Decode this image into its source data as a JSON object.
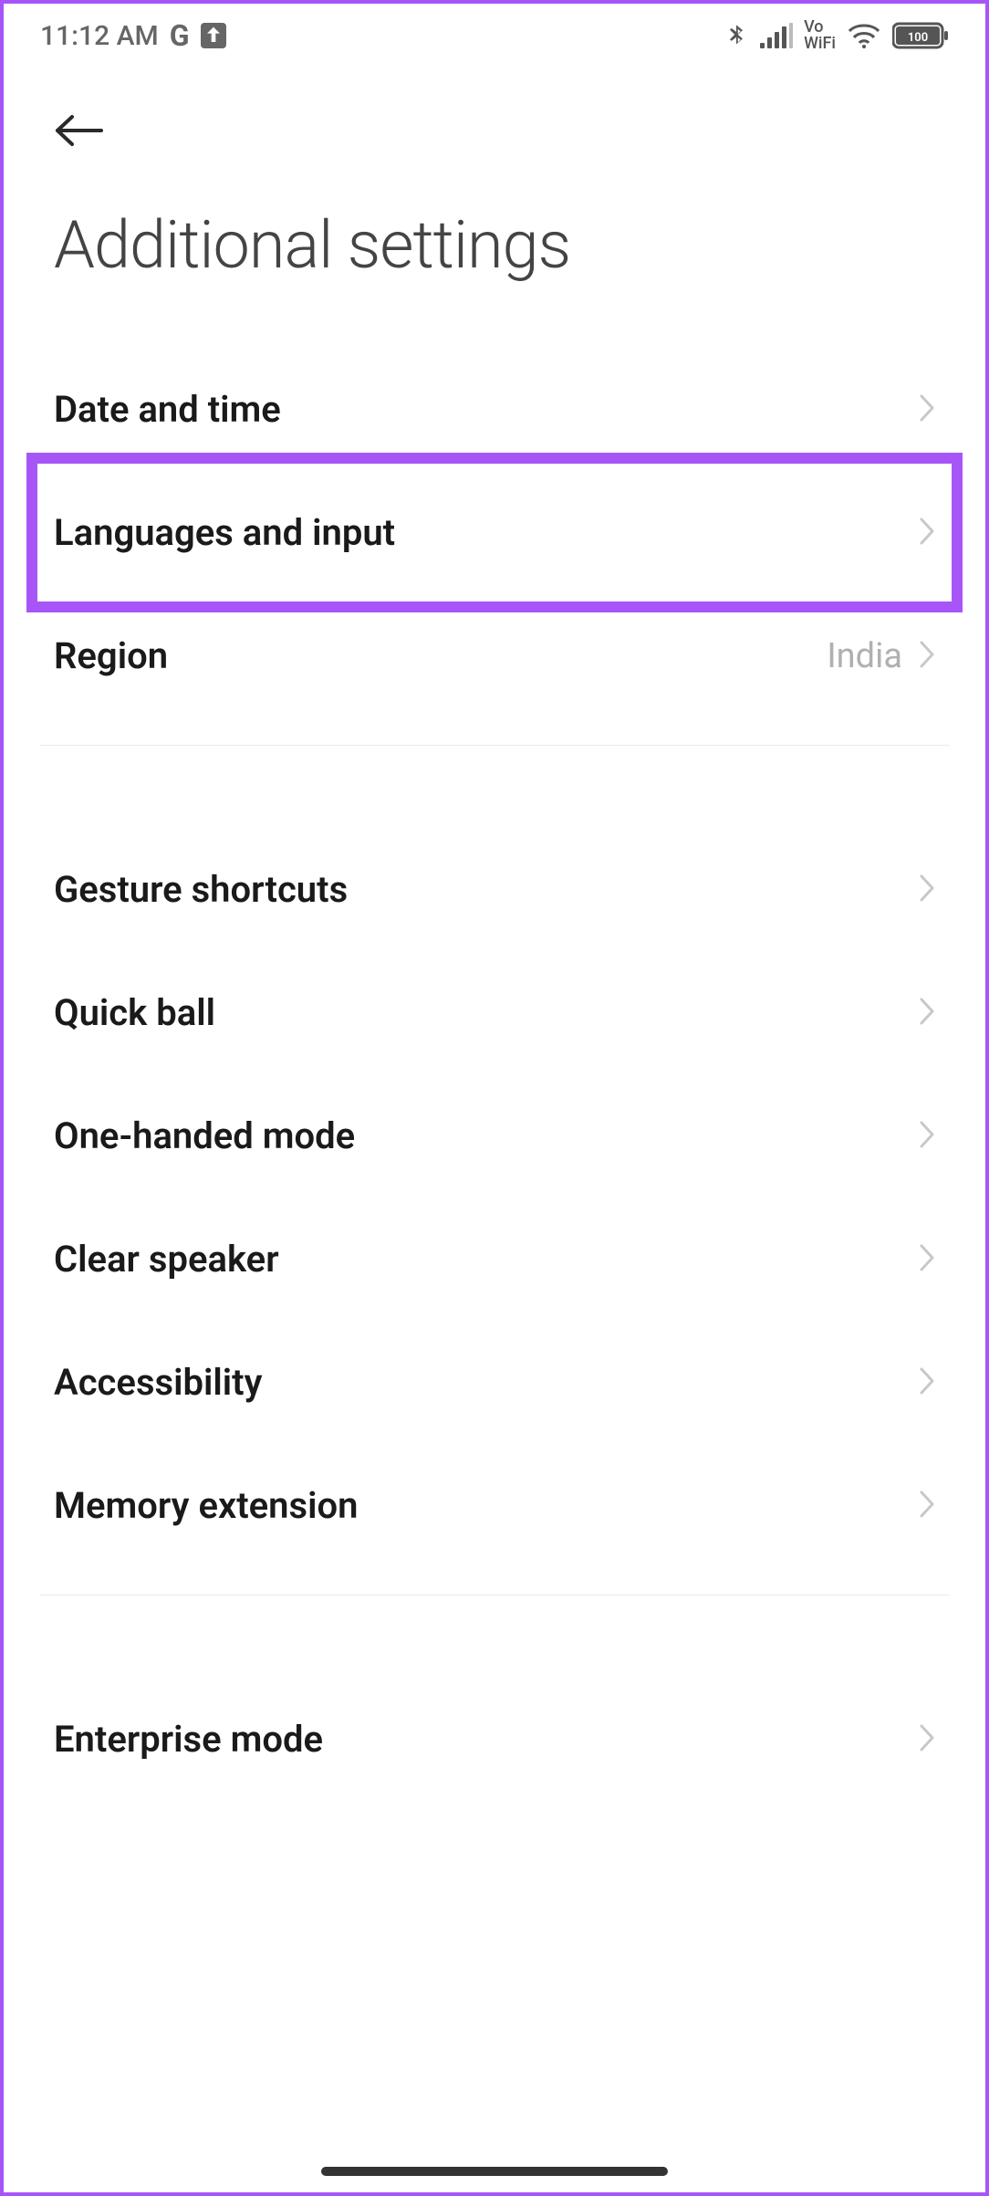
{
  "status": {
    "time": "11:12 AM",
    "g_label": "G",
    "vowifi_top": "Vo",
    "vowifi_bottom": "WiFi",
    "battery_label": "100"
  },
  "header": {
    "title": "Additional settings"
  },
  "sections": [
    {
      "items": [
        {
          "label": "Date and time",
          "value": "",
          "highlighted": false
        },
        {
          "label": "Languages and input",
          "value": "",
          "highlighted": true
        },
        {
          "label": "Region",
          "value": "India",
          "highlighted": false
        }
      ]
    },
    {
      "items": [
        {
          "label": "Gesture shortcuts",
          "value": "",
          "highlighted": false
        },
        {
          "label": "Quick ball",
          "value": "",
          "highlighted": false
        },
        {
          "label": "One-handed mode",
          "value": "",
          "highlighted": false
        },
        {
          "label": "Clear speaker",
          "value": "",
          "highlighted": false
        },
        {
          "label": "Accessibility",
          "value": "",
          "highlighted": false
        },
        {
          "label": "Memory extension",
          "value": "",
          "highlighted": false
        }
      ]
    },
    {
      "items": [
        {
          "label": "Enterprise mode",
          "value": "",
          "highlighted": false
        }
      ]
    }
  ]
}
